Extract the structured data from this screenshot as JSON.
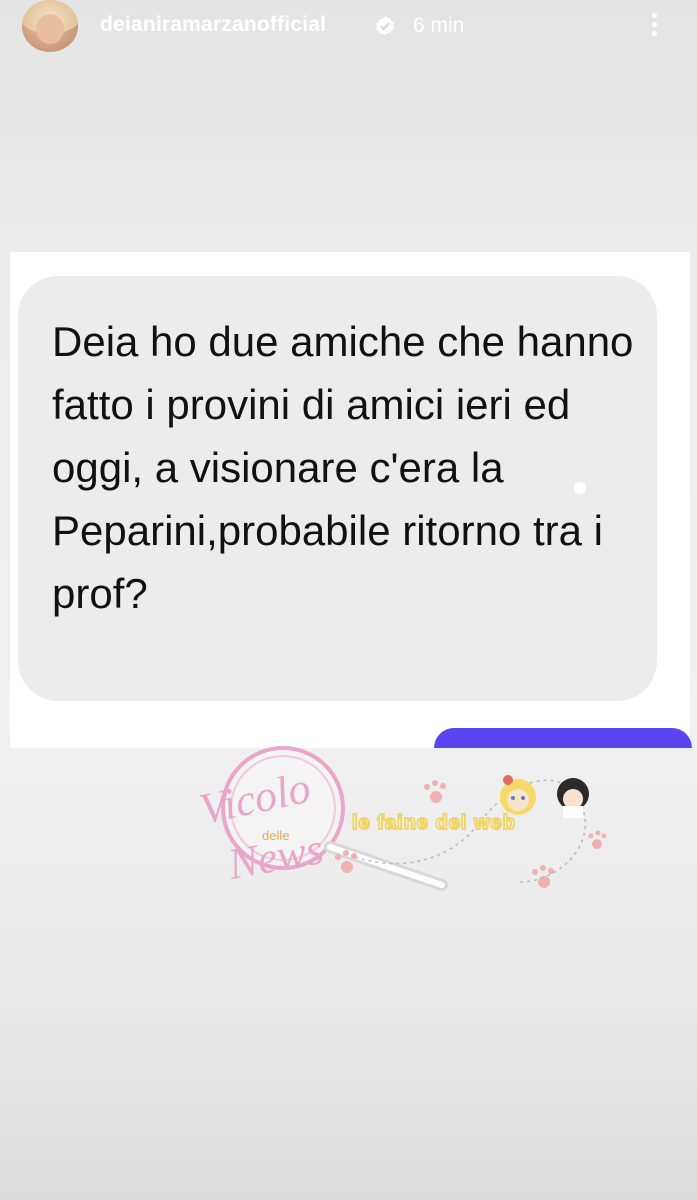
{
  "story_header": {
    "username": "deianiramarzanofficial",
    "time": "6 min",
    "verified_icon": "verified-badge-icon",
    "menu_icon": "more-vertical-icon"
  },
  "message": {
    "text": "Deia ho due amiche che hanno fatto i provini di amici ieri ed oggi, a visionare c'era la Peparini,probabile ritorno tra i prof?"
  },
  "watermark": {
    "brand_line1": "Vicolo",
    "brand_small": "delle",
    "brand_line2": "News",
    "partner": "le faine del web"
  },
  "colors": {
    "bubble": "#ececec",
    "sent_bubble": "#5b45f1",
    "watermark_pink": "#e8a6c8"
  }
}
